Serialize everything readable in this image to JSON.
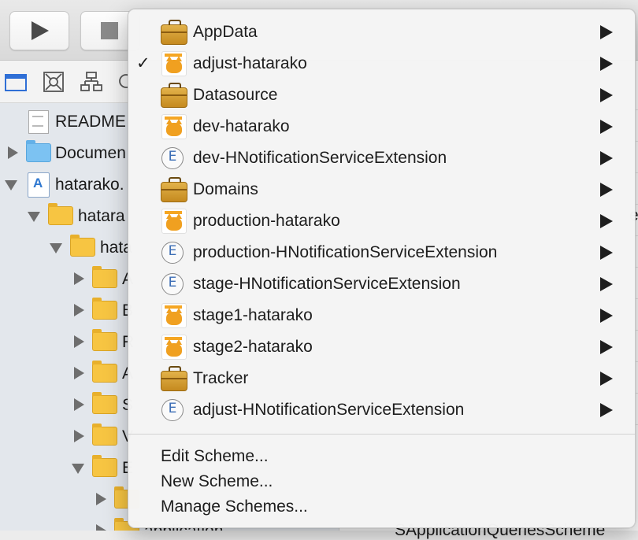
{
  "toolbar": {
    "run_icon": "play-icon",
    "stop_icon": "stop-icon"
  },
  "navigator": {
    "rows": [
      {
        "label": "README",
        "icon": "document-icon",
        "disclosure": "none"
      },
      {
        "label": "Documen",
        "icon": "blue-folder-icon",
        "disclosure": "closed"
      },
      {
        "label": "hatarako.",
        "icon": "xcode-project-icon",
        "disclosure": "open"
      },
      {
        "label": "hatara",
        "icon": "folder-icon",
        "disclosure": "open"
      },
      {
        "label": "hata",
        "icon": "folder-icon",
        "disclosure": "open"
      },
      {
        "label": "A",
        "icon": "folder-icon",
        "disclosure": "closed"
      },
      {
        "label": "B",
        "icon": "folder-icon",
        "disclosure": "closed"
      },
      {
        "label": "R",
        "icon": "folder-icon",
        "disclosure": "closed"
      },
      {
        "label": "A",
        "icon": "folder-icon",
        "disclosure": "closed"
      },
      {
        "label": "S",
        "icon": "folder-icon",
        "disclosure": "closed"
      },
      {
        "label": "V",
        "icon": "folder-icon",
        "disclosure": "closed"
      },
      {
        "label": "E",
        "icon": "folder-icon",
        "disclosure": "open"
      },
      {
        "label": "",
        "icon": "folder-icon",
        "disclosure": "closed"
      },
      {
        "label": "application",
        "icon": "folder-icon",
        "disclosure": "closed"
      }
    ]
  },
  "editor": {
    "peek_text_1": "e",
    "peek_text_2": "SApplicationQueriesScheme"
  },
  "scheme_menu": {
    "schemes": [
      {
        "label": "AppData",
        "icon": "briefcase-icon",
        "checked": false
      },
      {
        "label": "adjust-hatarako",
        "icon": "app-icon",
        "checked": true
      },
      {
        "label": "Datasource",
        "icon": "briefcase-icon",
        "checked": false
      },
      {
        "label": "dev-hatarako",
        "icon": "app-icon",
        "checked": false
      },
      {
        "label": "dev-HNotificationServiceExtension",
        "icon": "extension-icon",
        "checked": false
      },
      {
        "label": "Domains",
        "icon": "briefcase-icon",
        "checked": false
      },
      {
        "label": "production-hatarako",
        "icon": "app-icon",
        "checked": false
      },
      {
        "label": "production-HNotificationServiceExtension",
        "icon": "extension-icon",
        "checked": false
      },
      {
        "label": "stage-HNotificationServiceExtension",
        "icon": "extension-icon",
        "checked": false
      },
      {
        "label": "stage1-hatarako",
        "icon": "app-icon",
        "checked": false
      },
      {
        "label": "stage2-hatarako",
        "icon": "app-icon",
        "checked": false
      },
      {
        "label": "Tracker",
        "icon": "briefcase-icon",
        "checked": false
      },
      {
        "label": "adjust-HNotificationServiceExtension",
        "icon": "extension-icon",
        "checked": false
      }
    ],
    "check_glyph": "✓",
    "extension_letter": "E",
    "actions": [
      {
        "label": "Edit Scheme..."
      },
      {
        "label": "New Scheme..."
      },
      {
        "label": "Manage Schemes..."
      }
    ]
  }
}
